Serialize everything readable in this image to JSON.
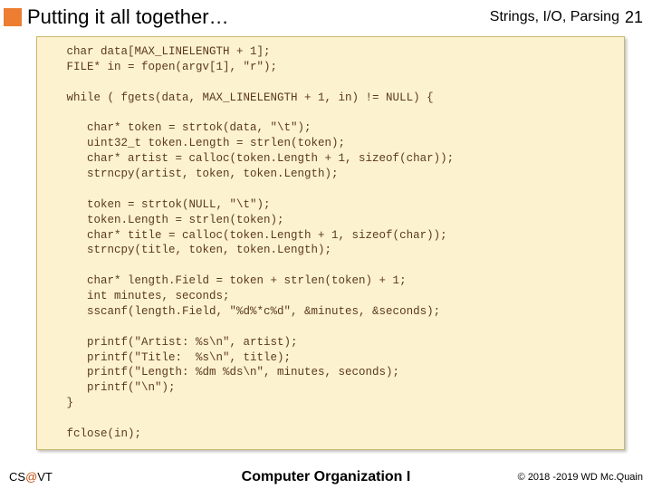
{
  "header": {
    "title": "Putting it all together…",
    "topic": "Strings, I/O, Parsing",
    "page": "21"
  },
  "code": "   char data[MAX_LINELENGTH + 1];\n   FILE* in = fopen(argv[1], \"r\");\n\n   while ( fgets(data, MAX_LINELENGTH + 1, in) != NULL) {\n\n      char* token = strtok(data, \"\\t\");\n      uint32_t token.Length = strlen(token);\n      char* artist = calloc(token.Length + 1, sizeof(char));\n      strncpy(artist, token, token.Length);\n\n      token = strtok(NULL, \"\\t\");\n      token.Length = strlen(token);\n      char* title = calloc(token.Length + 1, sizeof(char));\n      strncpy(title, token, token.Length);\n\n      char* length.Field = token + strlen(token) + 1;\n      int minutes, seconds;\n      sscanf(length.Field, \"%d%*c%d\", &minutes, &seconds);\n\n      printf(\"Artist: %s\\n\", artist);\n      printf(\"Title:  %s\\n\", title);\n      printf(\"Length: %dm %ds\\n\", minutes, seconds);\n      printf(\"\\n\");\n   }\n\n   fclose(in);",
  "footer": {
    "left_prefix": "CS",
    "left_at": "@",
    "left_suffix": "VT",
    "center": "Computer Organization I",
    "right": "© 2018 -2019 WD Mc.Quain"
  }
}
